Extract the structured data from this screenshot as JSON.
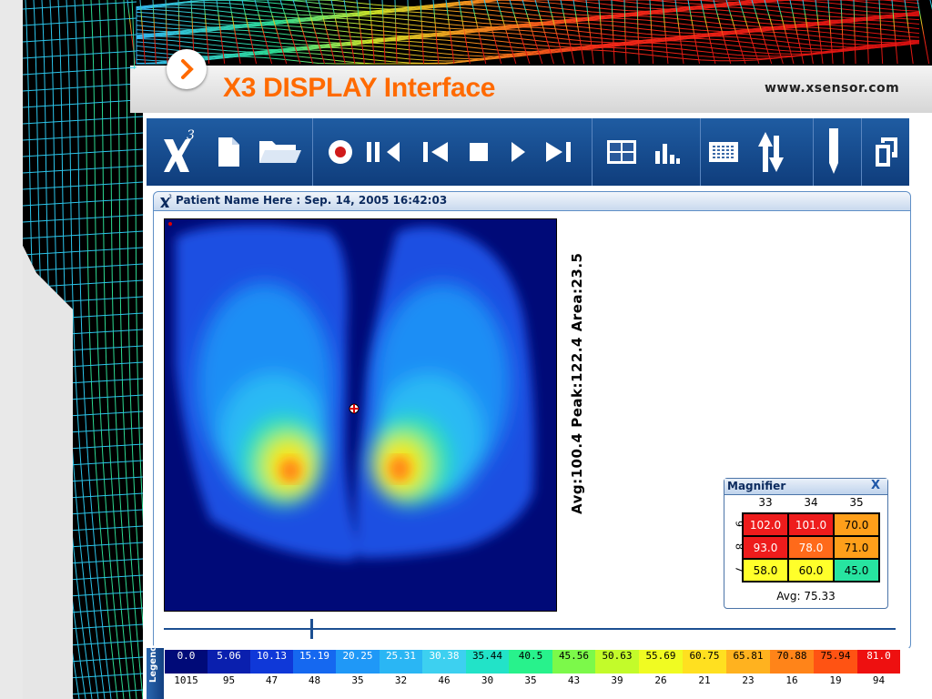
{
  "slide": {
    "title": "X3 DISPLAY Interface",
    "url": "www.xsensor.com"
  },
  "toolbar": {
    "buttons": [
      {
        "name": "x3-logo-icon"
      },
      {
        "name": "new-file-icon"
      },
      {
        "name": "open-folder-icon"
      },
      {
        "name": "record-icon"
      },
      {
        "name": "pause-rewind-icon"
      },
      {
        "name": "skip-start-icon"
      },
      {
        "name": "stop-icon"
      },
      {
        "name": "play-icon"
      },
      {
        "name": "skip-end-icon"
      },
      {
        "name": "grid-view-icon"
      },
      {
        "name": "bar-chart-icon"
      },
      {
        "name": "data-table-icon"
      },
      {
        "name": "sort-arrows-icon"
      },
      {
        "name": "pen-icon"
      },
      {
        "name": "restore-window-icon"
      }
    ]
  },
  "panel": {
    "title": "Patient Name Here : Sep. 14, 2005 16:42:03"
  },
  "stats": {
    "text": "Avg:100.4 Peak:122.4 Area:23.5"
  },
  "magnifier": {
    "title": "Magnifier",
    "close": "X",
    "columns": [
      "33",
      "34",
      "35"
    ],
    "rows": [
      "9",
      "8",
      "7"
    ],
    "cells": [
      [
        {
          "v": "102.0",
          "bg": "#ee1c1c",
          "fg": "#ffffff"
        },
        {
          "v": "101.0",
          "bg": "#ee1c1c",
          "fg": "#ffffff"
        },
        {
          "v": "70.0",
          "bg": "#ff9f1a",
          "fg": "#000000"
        }
      ],
      [
        {
          "v": "93.0",
          "bg": "#ee1c1c",
          "fg": "#ffffff"
        },
        {
          "v": "78.0",
          "bg": "#ff6a1a",
          "fg": "#ffffff"
        },
        {
          "v": "71.0",
          "bg": "#ff9f1a",
          "fg": "#000000"
        }
      ],
      [
        {
          "v": "58.0",
          "bg": "#ffff2a",
          "fg": "#000000"
        },
        {
          "v": "60.0",
          "bg": "#ffff2a",
          "fg": "#000000"
        },
        {
          "v": "45.0",
          "bg": "#27e4a0",
          "fg": "#000000"
        }
      ]
    ],
    "avg": "Avg: 75.33"
  },
  "slider": {
    "position": 0.2
  },
  "legend": {
    "tab_label": "Legend",
    "values": [
      "0.0",
      "5.06",
      "10.13",
      "15.19",
      "20.25",
      "25.31",
      "30.38",
      "35.44",
      "40.5",
      "45.56",
      "50.63",
      "55.69",
      "60.75",
      "65.81",
      "70.88",
      "75.94",
      "81.0"
    ],
    "counts": [
      "1015",
      "95",
      "47",
      "48",
      "35",
      "32",
      "46",
      "30",
      "35",
      "43",
      "39",
      "26",
      "21",
      "23",
      "16",
      "19",
      "94"
    ],
    "colors": [
      "#000a78",
      "#0a1fae",
      "#0f38d8",
      "#1568f0",
      "#1f98f7",
      "#2ab6f4",
      "#3dd0f0",
      "#22e3c8",
      "#28f28c",
      "#7cf94a",
      "#c3fb2a",
      "#f0fb22",
      "#ffe020",
      "#ffb21f",
      "#ff8419",
      "#ff5313",
      "#ee1010"
    ],
    "text_colors": [
      "#ffffff",
      "#ffffff",
      "#ffffff",
      "#ffffff",
      "#ffffff",
      "#ffffff",
      "#ffffff",
      "#000000",
      "#000000",
      "#000000",
      "#000000",
      "#000000",
      "#000000",
      "#000000",
      "#000000",
      "#000000",
      "#ffffff"
    ]
  },
  "colors": {
    "accent": "#ff6a00",
    "toolbar_blue": "#1b4f92"
  }
}
